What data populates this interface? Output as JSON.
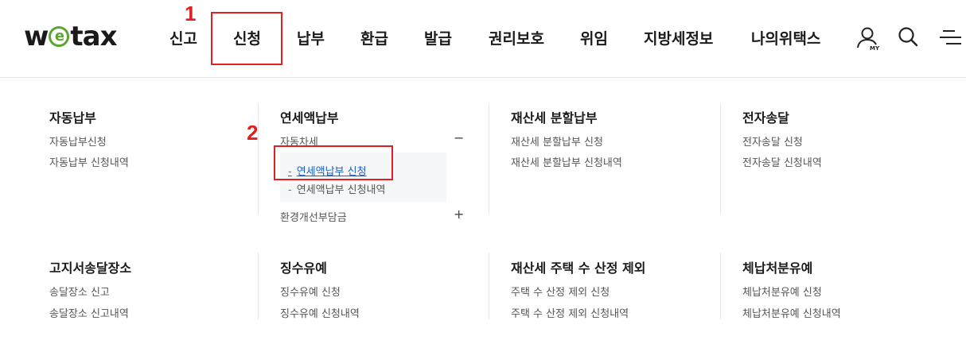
{
  "logo": {
    "text_prefix": "w",
    "text_e": "e",
    "text_suffix": "tax"
  },
  "nav": {
    "items": [
      {
        "label": "신고"
      },
      {
        "label": "신청"
      },
      {
        "label": "납부"
      },
      {
        "label": "환급"
      },
      {
        "label": "발급"
      },
      {
        "label": "권리보호"
      },
      {
        "label": "위임"
      },
      {
        "label": "지방세정보"
      },
      {
        "label": "나의위택스"
      }
    ]
  },
  "header_icons": [
    "my-page-icon",
    "search-icon",
    "menu-icon"
  ],
  "my_icon_label": "MY",
  "annotations": {
    "one": "1",
    "two": "2",
    "color": "#e02020"
  },
  "menu": {
    "sections": [
      {
        "title": "자동납부",
        "links": [
          "자동납부신청",
          "자동납부 신청내역"
        ]
      },
      {
        "title": "연세액납부",
        "group1": {
          "label": "자동차세",
          "toggle": "−",
          "items": [
            "연세액납부 신청",
            "연세액납부 신청내역"
          ]
        },
        "group2": {
          "label": "환경개선부담금",
          "toggle": "+"
        }
      },
      {
        "title": "재산세 분할납부",
        "links": [
          "재산세 분할납부 신청",
          "재산세 분할납부 신청내역"
        ]
      },
      {
        "title": "전자송달",
        "links": [
          "전자송달 신청",
          "전자송달 신청내역"
        ]
      },
      {
        "title": "고지서송달장소",
        "links": [
          "송달장소 신고",
          "송달장소 신고내역"
        ]
      },
      {
        "title": "징수유예",
        "links": [
          "징수유예 신청",
          "징수유예 신청내역"
        ]
      },
      {
        "title": "재산세 주택 수 산정 제외",
        "links": [
          "주택 수 산정 제외 신청",
          "주택 수 산정 제외 신청내역"
        ]
      },
      {
        "title": "체납처분유예",
        "links": [
          "체납처분유예 신청",
          "체납처분유예 신청내역"
        ]
      }
    ]
  },
  "colors": {
    "accent_green": "#5aa631",
    "active_link": "#1a5fc7"
  }
}
